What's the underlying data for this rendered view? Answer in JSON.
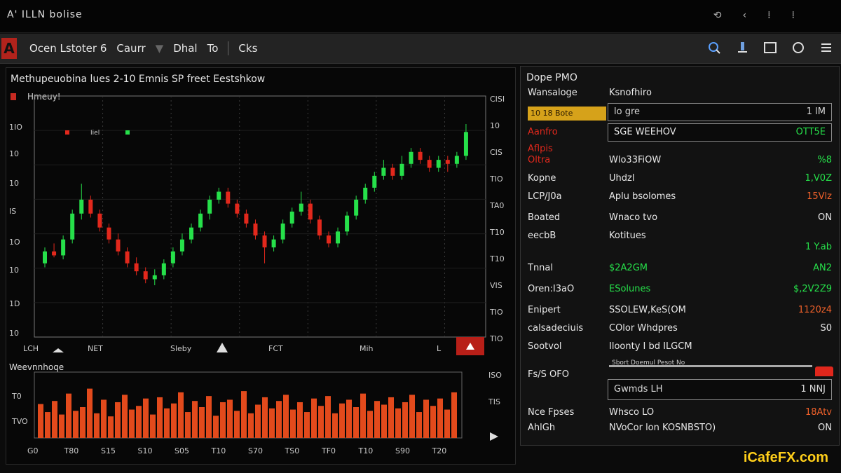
{
  "window": {
    "title": "A' ILLN bolise"
  },
  "title_controls": [
    "⟲",
    "‹",
    "⁞",
    "⁞"
  ],
  "toolbar": {
    "logo": "A",
    "menu": [
      "Ocen Lstoter 6",
      "Caurr",
      "Dhal",
      "To",
      "Cks"
    ],
    "icons": [
      "search-icon",
      "pin-icon",
      "window-icon",
      "circle-icon",
      "menu-icon"
    ]
  },
  "chart": {
    "title": "Methupeuobina lues 2-10 Emnis SP freet Eestshkow",
    "subtitle": "Hmeuy!",
    "legend_tag": "Iiel",
    "x_labels": [
      "LCH",
      "NET",
      "Sleby",
      "FCT",
      "Mih",
      "L"
    ],
    "y_labels": [
      "1IO",
      "10",
      "10",
      "IS",
      "1O",
      "10",
      "1D",
      "10"
    ],
    "right_labels": [
      "CISI",
      "10",
      "CIS",
      "TIO",
      "TA0",
      "T10",
      "T10",
      "VIS",
      "TIO",
      "TIO"
    ],
    "volume_title": "Weevnnhoqe",
    "volume_y_labels": [
      "T0",
      "TVO"
    ],
    "volume_right_labels": [
      "ISO",
      "TIS"
    ],
    "volume_x_labels": [
      "G0",
      "T80",
      "S15",
      "S10",
      "S05",
      "T10",
      "S70",
      "TS0",
      "TF0",
      "T10",
      "S90",
      "T20"
    ]
  },
  "chart_data": {
    "type": "candlestick",
    "colors": {
      "up": "#26e04a",
      "down": "#e2281c",
      "volume": "#e24a1c",
      "grid": "#3a3a3a"
    },
    "ohlc_shape": [
      [
        0.3,
        0.36,
        0.28,
        0.38
      ],
      [
        0.36,
        0.34,
        0.33,
        0.4
      ],
      [
        0.34,
        0.42,
        0.32,
        0.44
      ],
      [
        0.42,
        0.55,
        0.4,
        0.57
      ],
      [
        0.55,
        0.62,
        0.52,
        0.7
      ],
      [
        0.62,
        0.55,
        0.53,
        0.64
      ],
      [
        0.55,
        0.48,
        0.46,
        0.57
      ],
      [
        0.48,
        0.42,
        0.4,
        0.5
      ],
      [
        0.42,
        0.36,
        0.34,
        0.45
      ],
      [
        0.36,
        0.3,
        0.28,
        0.38
      ],
      [
        0.3,
        0.26,
        0.24,
        0.33
      ],
      [
        0.26,
        0.22,
        0.2,
        0.28
      ],
      [
        0.22,
        0.24,
        0.19,
        0.27
      ],
      [
        0.24,
        0.3,
        0.22,
        0.32
      ],
      [
        0.3,
        0.36,
        0.28,
        0.38
      ],
      [
        0.36,
        0.42,
        0.34,
        0.45
      ],
      [
        0.42,
        0.48,
        0.4,
        0.5
      ],
      [
        0.48,
        0.55,
        0.46,
        0.57
      ],
      [
        0.55,
        0.62,
        0.52,
        0.64
      ],
      [
        0.62,
        0.66,
        0.6,
        0.68
      ],
      [
        0.66,
        0.6,
        0.58,
        0.68
      ],
      [
        0.6,
        0.55,
        0.53,
        0.62
      ],
      [
        0.55,
        0.5,
        0.48,
        0.57
      ],
      [
        0.5,
        0.44,
        0.42,
        0.52
      ],
      [
        0.44,
        0.38,
        0.3,
        0.46
      ],
      [
        0.38,
        0.42,
        0.36,
        0.44
      ],
      [
        0.42,
        0.5,
        0.4,
        0.52
      ],
      [
        0.5,
        0.56,
        0.48,
        0.58
      ],
      [
        0.56,
        0.6,
        0.54,
        0.66
      ],
      [
        0.6,
        0.52,
        0.5,
        0.62
      ],
      [
        0.52,
        0.44,
        0.42,
        0.54
      ],
      [
        0.44,
        0.4,
        0.38,
        0.46
      ],
      [
        0.4,
        0.46,
        0.38,
        0.48
      ],
      [
        0.46,
        0.54,
        0.44,
        0.56
      ],
      [
        0.54,
        0.62,
        0.52,
        0.64
      ],
      [
        0.62,
        0.68,
        0.6,
        0.7
      ],
      [
        0.68,
        0.74,
        0.66,
        0.76
      ],
      [
        0.74,
        0.78,
        0.72,
        0.82
      ],
      [
        0.78,
        0.74,
        0.72,
        0.8
      ],
      [
        0.74,
        0.8,
        0.72,
        0.84
      ],
      [
        0.8,
        0.86,
        0.78,
        0.88
      ],
      [
        0.86,
        0.82,
        0.8,
        0.88
      ],
      [
        0.82,
        0.78,
        0.76,
        0.84
      ],
      [
        0.78,
        0.82,
        0.76,
        0.84
      ],
      [
        0.82,
        0.8,
        0.76,
        0.84
      ],
      [
        0.8,
        0.84,
        0.78,
        0.86
      ],
      [
        0.84,
        0.96,
        0.82,
        1.0
      ]
    ],
    "volume_shape": [
      0.55,
      0.42,
      0.6,
      0.38,
      0.72,
      0.44,
      0.5,
      0.8,
      0.4,
      0.62,
      0.35,
      0.58,
      0.7,
      0.46,
      0.52,
      0.64,
      0.38,
      0.66,
      0.48,
      0.56,
      0.74,
      0.42,
      0.6,
      0.5,
      0.68,
      0.36,
      0.58,
      0.62,
      0.44,
      0.76,
      0.4,
      0.54,
      0.66,
      0.48,
      0.6,
      0.7,
      0.46,
      0.58,
      0.42,
      0.64,
      0.52,
      0.68,
      0.4,
      0.56,
      0.62,
      0.5,
      0.72,
      0.44,
      0.6,
      0.54,
      0.66,
      0.48,
      0.58,
      0.7,
      0.42,
      0.62,
      0.52,
      0.64,
      0.46,
      0.74
    ]
  },
  "side_panel": {
    "title": "Dope PMO",
    "rows": [
      {
        "l": "Wansaloge",
        "m": "Ksnofhiro",
        "r": "",
        "lc": "#e8e8e8",
        "mc": "#e8e8e8",
        "rc": "#e8e8e8"
      },
      {
        "l": "",
        "m": "",
        "r": "",
        "lc": "#e8e8e8",
        "mc": "#e8e8e8",
        "rc": "#e8e8e8"
      },
      {
        "l": "Aanfro",
        "m": "",
        "r": "",
        "lc": "#e2281c",
        "mc": "#e8e8e8",
        "rc": "#e8e8e8"
      },
      {
        "l": "Aflpis",
        "m": "",
        "r": "",
        "lc": "#e2281c",
        "mc": "#e8e8e8",
        "rc": "#e8e8e8"
      },
      {
        "l": "Oltra",
        "m": "Wlo33FiOW",
        "r": "%8",
        "lc": "#e2281c",
        "mc": "#e8e8e8",
        "rc": "#26e04a"
      },
      {
        "l": "Kopne",
        "m": "Uhdzl",
        "r": "1,V0Z",
        "lc": "#e8e8e8",
        "mc": "#e8e8e8",
        "rc": "#26e04a"
      },
      {
        "l": "LCP/J0a",
        "m": "Aplu bsolomes",
        "r": "15Vlz",
        "lc": "#e8e8e8",
        "mc": "#e8e8e8",
        "rc": "#f0612a"
      },
      {
        "l": "Boated",
        "m": "Wnaco tvo",
        "r": "ON",
        "lc": "#e8e8e8",
        "mc": "#e8e8e8",
        "rc": "#e8e8e8"
      },
      {
        "l": "eecbB",
        "m": "Kotitues",
        "r": "",
        "lc": "#e8e8e8",
        "mc": "#e8e8e8",
        "rc": "#e8e8e8"
      },
      {
        "l": "",
        "m": "",
        "r": "1 Y.ab",
        "lc": "#e8e8e8",
        "mc": "#e8e8e8",
        "rc": "#26e04a"
      },
      {
        "l": "Tnnal",
        "m": "$2A2GM",
        "r": "AN2",
        "lc": "#e8e8e8",
        "mc": "#26e04a",
        "rc": "#26e04a"
      },
      {
        "l": "Oren:I3aO",
        "m": "ESolunes",
        "r": "$,2V2Z9",
        "lc": "#e8e8e8",
        "mc": "#26e04a",
        "rc": "#26e04a"
      },
      {
        "l": "Enipert",
        "m": "SSOLEW,KeS(OM",
        "r": "1120z4",
        "lc": "#e8e8e8",
        "mc": "#e8e8e8",
        "rc": "#f0612a"
      },
      {
        "l": "calsadeciuis",
        "m": "COlor Whdpres",
        "r": "S0",
        "lc": "#e8e8e8",
        "mc": "#e8e8e8",
        "rc": "#e8e8e8"
      },
      {
        "l": "Sootvol",
        "m": "Iloonty I bd ILGCM",
        "r": "",
        "lc": "#e8e8e8",
        "mc": "#e8e8e8",
        "rc": "#e8e8e8"
      },
      {
        "l": "",
        "m": "",
        "r": "",
        "lc": "#e8e8e8",
        "mc": "#e8e8e8",
        "rc": "#e8e8e8"
      },
      {
        "l": "Fs/S OFO",
        "m": "",
        "r": "",
        "lc": "#e8e8e8",
        "mc": "#e8e8e8",
        "rc": "#e8e8e8"
      },
      {
        "l": "",
        "m": "",
        "r": "",
        "lc": "#e8e8e8",
        "mc": "#e8e8e8",
        "rc": "#e8e8e8"
      },
      {
        "l": "Nce Fpses",
        "m": "Whsco LO",
        "r": "18Atv",
        "lc": "#e8e8e8",
        "mc": "#e8e8e8",
        "rc": "#f0612a"
      },
      {
        "l": "AhlGh",
        "m": "NVoCor lon KOSNBSTO)",
        "r": "ON",
        "lc": "#e8e8e8",
        "mc": "#e8e8e8",
        "rc": "#e8e8e8"
      }
    ],
    "amber_label": "10 18 Bote",
    "box1": {
      "m": "lo gre",
      "r": "1 lM"
    },
    "box2": {
      "m": "SGE WEEHOV",
      "r": "OTT5E"
    },
    "box3": {
      "m": "Gwmds LH",
      "r": "1 NNJ"
    },
    "bar_caption": "Sbort Doemul Pesot No"
  },
  "watermark": "iCafeFX.com"
}
